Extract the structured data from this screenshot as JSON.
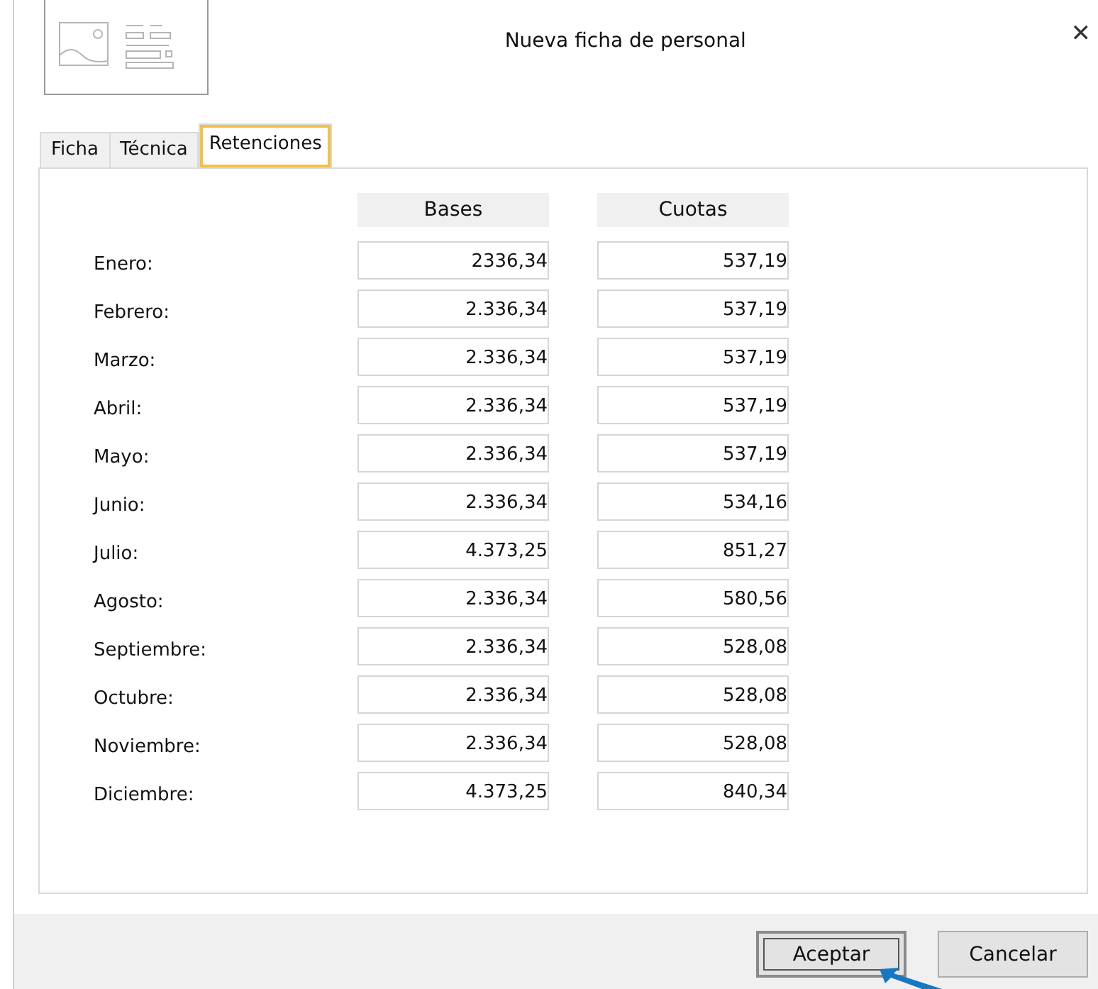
{
  "window": {
    "title": "Nueva ficha de personal",
    "close": "✕"
  },
  "tabs": [
    {
      "label": "Ficha",
      "selected": false
    },
    {
      "label": "Técnica",
      "selected": false
    },
    {
      "label": "Retenciones",
      "selected": true
    }
  ],
  "columns": [
    "Bases",
    "Cuotas"
  ],
  "rows": [
    {
      "month": "Enero:",
      "base": "2336,34",
      "cuota": "537,19"
    },
    {
      "month": "Febrero:",
      "base": "2.336,34",
      "cuota": "537,19"
    },
    {
      "month": "Marzo:",
      "base": "2.336,34",
      "cuota": "537,19"
    },
    {
      "month": "Abril:",
      "base": "2.336,34",
      "cuota": "537,19"
    },
    {
      "month": "Mayo:",
      "base": "2.336,34",
      "cuota": "537,19"
    },
    {
      "month": "Junio:",
      "base": "2.336,34",
      "cuota": "534,16"
    },
    {
      "month": "Julio:",
      "base": "4.373,25",
      "cuota": "851,27"
    },
    {
      "month": "Agosto:",
      "base": "2.336,34",
      "cuota": "580,56"
    },
    {
      "month": "Septiembre:",
      "base": "2.336,34",
      "cuota": "528,08"
    },
    {
      "month": "Octubre:",
      "base": "2.336,34",
      "cuota": "528,08"
    },
    {
      "month": "Noviembre:",
      "base": "2.336,34",
      "cuota": "528,08"
    },
    {
      "month": "Diciembre:",
      "base": "4.373,25",
      "cuota": "840,34"
    }
  ],
  "buttons": [
    {
      "label": "Aceptar",
      "default": true
    },
    {
      "label": "Cancelar",
      "default": false
    }
  ]
}
